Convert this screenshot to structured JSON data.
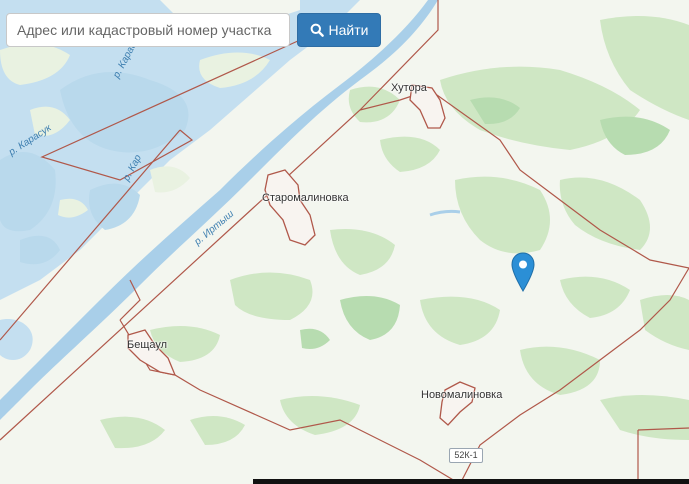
{
  "search": {
    "placeholder": "Адрес или кадастровый номер участка",
    "value": "",
    "button_label": "Найти",
    "button_icon": "search-icon"
  },
  "places": {
    "khutora": "Хутора",
    "staromalinovka": "Старомалиновка",
    "beshchaul": "Бещаул",
    "novomalinovka": "Новомалиновка"
  },
  "water_labels": {
    "karasuk_1": "р. Карасук",
    "karasuk_2": "р. Карасук",
    "karasuk_3": "р. Кар",
    "irtysh": "р. Иртыш"
  },
  "road": {
    "number": "52К-1"
  },
  "marker": {
    "icon": "map-pin-icon",
    "color": "#2b8fd6"
  },
  "colors": {
    "water": "#c4dff0",
    "river": "#a9cfe9",
    "forest": "#cfe7c4",
    "forest_dark": "#b7dcb0",
    "boundary": "#b0584a",
    "button": "#337ab7"
  }
}
